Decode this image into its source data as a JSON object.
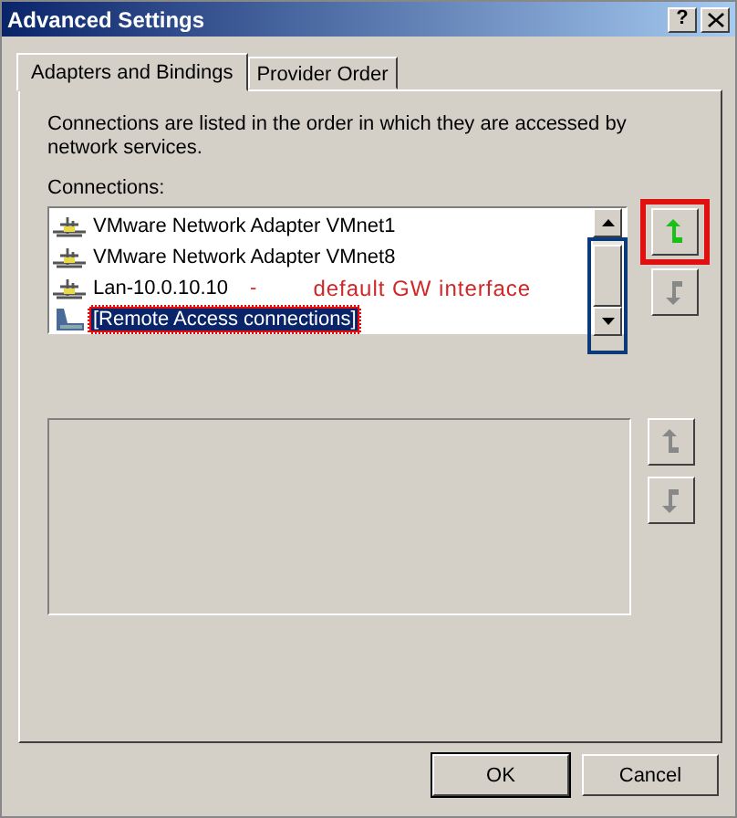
{
  "window": {
    "title": "Advanced Settings",
    "help": "?"
  },
  "tabs": [
    {
      "label": "Adapters and Bindings",
      "selected": true
    },
    {
      "label": "Provider Order",
      "selected": false
    }
  ],
  "description": "Connections are listed in the order in which they are accessed by network services.",
  "connections_label": "Connections:",
  "connections": [
    {
      "kind": "adapter",
      "label": "VMware Network Adapter VMnet1",
      "selected": false,
      "highlighted": false
    },
    {
      "kind": "adapter",
      "label": "VMware Network Adapter VMnet8",
      "selected": false,
      "highlighted": false
    },
    {
      "kind": "adapter",
      "label": "Lan-10.0.10.10",
      "selected": false,
      "highlighted": false,
      "dash": "-",
      "note": "default GW interface"
    },
    {
      "kind": "remote",
      "label": "[Remote Access connections]",
      "selected": true,
      "highlighted": true
    }
  ],
  "scrollbar_highlighted": true,
  "move_buttons": [
    {
      "kind": "up",
      "disabled": false,
      "highlighted": true
    },
    {
      "kind": "down",
      "disabled": true,
      "highlighted": false
    }
  ],
  "second_move_buttons": [
    {
      "kind": "up",
      "disabled": true
    },
    {
      "kind": "down",
      "disabled": true
    }
  ],
  "buttons": [
    {
      "label": "OK",
      "default": true
    },
    {
      "label": "Cancel",
      "default": false
    }
  ]
}
